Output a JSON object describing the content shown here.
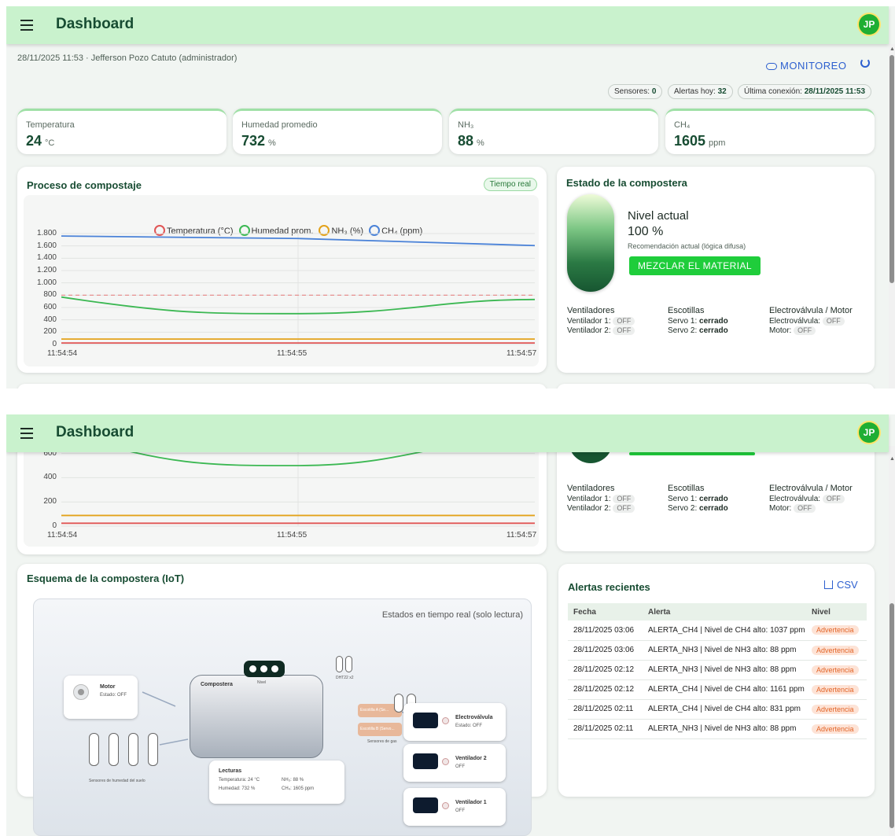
{
  "app": {
    "title": "Dashboard",
    "avatar_initials": "JP"
  },
  "header_meta": "28/11/2025 11:53 · Jefferson Pozo Catuto (administrador)",
  "actions": {
    "monitor_label": "MONITOREO"
  },
  "status_chips": {
    "sensores_label": "Sensores:",
    "sensores_value": "0",
    "alertas_label": "Alertas hoy:",
    "alertas_value": "32",
    "conexion_label": "Última conexión:",
    "conexion_value": "28/11/2025 11:53"
  },
  "metrics": [
    {
      "label": "Temperatura",
      "value": "24",
      "unit": "°C"
    },
    {
      "label": "Humedad promedio",
      "value": "732",
      "unit": "%"
    },
    {
      "label": "NH₃",
      "value": "88",
      "unit": "%"
    },
    {
      "label": "CH₄",
      "value": "1605",
      "unit": "ppm"
    }
  ],
  "process_card": {
    "title": "Proceso de compostaje",
    "badge": "Tiempo real"
  },
  "chart_data": {
    "type": "line",
    "title": "",
    "x": [
      "11:54:54",
      "11:54:55",
      "11:54:57"
    ],
    "ylim": [
      0,
      1800
    ],
    "y_ticks": [
      "1.800",
      "1.600",
      "1.400",
      "1.200",
      "1.000",
      "800",
      "600",
      "400",
      "200",
      "0"
    ],
    "y_ticks_scrolled": [
      "1.000",
      "800",
      "600",
      "400",
      "200",
      "0"
    ],
    "threshold": 800,
    "grid": true,
    "legend_position": "top",
    "series": [
      {
        "name": "Temperatura (°C)",
        "color": "#e05555",
        "values": [
          24,
          24,
          24
        ]
      },
      {
        "name": "Humedad prom.",
        "color": "#3cb853",
        "values": [
          770,
          500,
          730
        ]
      },
      {
        "name": "NH₃ (%)",
        "color": "#e3a21a",
        "values": [
          88,
          88,
          88
        ]
      },
      {
        "name": "CH₄ (ppm)",
        "color": "#4a82d8",
        "values": [
          1760,
          1720,
          1605
        ]
      }
    ]
  },
  "estado": {
    "title": "Estado de la compostera",
    "nivel_label": "Nivel actual",
    "nivel_value": "100 %",
    "recomendacion_label": "Recomendación actual (lógica difusa)",
    "recomendacion_button": "MEZCLAR EL MATERIAL",
    "ventiladores": {
      "title": "Ventiladores",
      "v1": "Ventilador 1:",
      "v2": "Ventilador 2:",
      "v1_state": "OFF",
      "v2_state": "OFF"
    },
    "escotillas": {
      "title": "Escotillas",
      "s1": "Servo 1:",
      "s2": "Servo 2:",
      "s1_state": "cerrado",
      "s2_state": "cerrado"
    },
    "electro": {
      "title": "Electroválvula / Motor",
      "ev": "Electroválvula:",
      "motor": "Motor:",
      "ev_state": "OFF",
      "motor_state": "OFF"
    }
  },
  "scheme": {
    "title": "Esquema de la compostera (IoT)",
    "note": "Estados en tiempo real (solo lectura)",
    "composter_label": "Compostera",
    "nivel_label": "Nivel",
    "dht_label": "DHT22 x2",
    "motor": {
      "title": "Motor",
      "state": "Estado: OFF"
    },
    "soil_label": "Sensores de humedad del suelo",
    "gas_label": "Sensores de gas",
    "escotilla_a": "Escotilla A (Se...",
    "escotilla_b": "Escotilla B (Servo...",
    "lecturas": {
      "title": "Lecturas",
      "temp": "Temperatura: 24 °C",
      "hum": "Humedad: 732 %",
      "nh3": "NH₃: 88 %",
      "ch4": "CH₄: 1605 ppm"
    },
    "electro": {
      "title": "Electroválvula",
      "state": "Estado: OFF"
    },
    "vent2": {
      "title": "Ventilador 2",
      "state": "OFF"
    },
    "vent1": {
      "title": "Ventilador 1",
      "state": "OFF"
    }
  },
  "alerts": {
    "title": "Alertas recientes",
    "csv_label": "CSV",
    "columns": [
      "Fecha",
      "Alerta",
      "Nivel"
    ],
    "rows": [
      {
        "fecha": "28/11/2025 03:06",
        "alerta": "ALERTA_CH4 | Nivel de CH4 alto: 1037 ppm",
        "nivel": "Advertencia"
      },
      {
        "fecha": "28/11/2025 03:06",
        "alerta": "ALERTA_NH3 | Nivel de NH3 alto: 88 ppm",
        "nivel": "Advertencia"
      },
      {
        "fecha": "28/11/2025 02:12",
        "alerta": "ALERTA_NH3 | Nivel de NH3 alto: 88 ppm",
        "nivel": "Advertencia"
      },
      {
        "fecha": "28/11/2025 02:12",
        "alerta": "ALERTA_CH4 | Nivel de CH4 alto: 1161 ppm",
        "nivel": "Advertencia"
      },
      {
        "fecha": "28/11/2025 02:11",
        "alerta": "ALERTA_CH4 | Nivel de CH4 alto: 831 ppm",
        "nivel": "Advertencia"
      },
      {
        "fecha": "28/11/2025 02:11",
        "alerta": "ALERTA_NH3 | Nivel de NH3 alto: 88 ppm",
        "nivel": "Advertencia"
      }
    ]
  }
}
